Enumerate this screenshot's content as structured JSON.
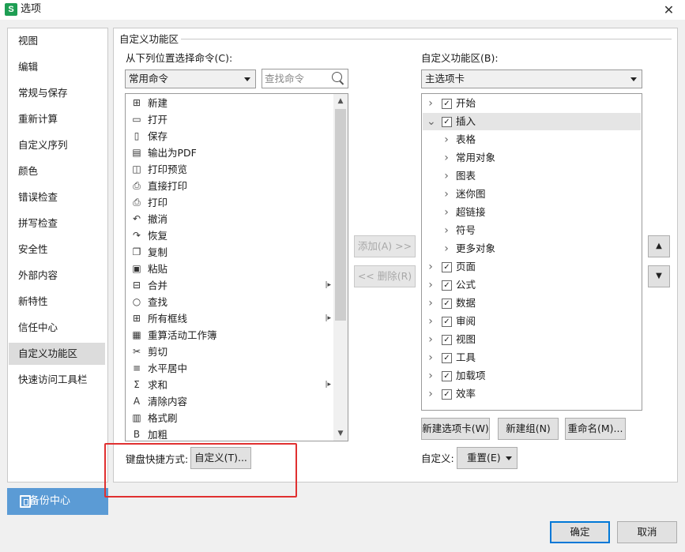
{
  "window": {
    "title": "选项",
    "app_badge": "S",
    "close_glyph": "✕"
  },
  "nav": {
    "items": [
      "视图",
      "编辑",
      "常规与保存",
      "重新计算",
      "自定义序列",
      "颜色",
      "错误检查",
      "拼写检查",
      "安全性",
      "外部内容",
      "新特性",
      "信任中心",
      "自定义功能区",
      "快速访问工具栏"
    ],
    "active": "自定义功能区"
  },
  "backup": {
    "label": "备份中心"
  },
  "section": {
    "title": "自定义功能区"
  },
  "left": {
    "choose_label": "从下列位置选择命令(C):",
    "choose_value": "常用命令",
    "search_placeholder": "查找命令",
    "commands": [
      {
        "label": "新建",
        "icon": "⊞"
      },
      {
        "label": "打开",
        "icon": "▭"
      },
      {
        "label": "保存",
        "icon": "▯"
      },
      {
        "label": "输出为PDF",
        "icon": "▤"
      },
      {
        "label": "打印预览",
        "icon": "◫"
      },
      {
        "label": "直接打印",
        "icon": "⎙"
      },
      {
        "label": "打印",
        "icon": "⎙"
      },
      {
        "label": "撤消",
        "icon": "↶"
      },
      {
        "label": "恢复",
        "icon": "↷"
      },
      {
        "label": "复制",
        "icon": "❐"
      },
      {
        "label": "粘贴",
        "icon": "▣"
      },
      {
        "label": "合并",
        "icon": "⊟",
        "submenu": true
      },
      {
        "label": "查找",
        "icon": "○"
      },
      {
        "label": "所有框线",
        "icon": "⊞",
        "submenu": true
      },
      {
        "label": "重算活动工作簿",
        "icon": "▦"
      },
      {
        "label": "剪切",
        "icon": "✂"
      },
      {
        "label": "水平居中",
        "icon": "≡"
      },
      {
        "label": "求和",
        "icon": "Σ",
        "submenu": true
      },
      {
        "label": "清除内容",
        "icon": "A"
      },
      {
        "label": "格式刷",
        "icon": "▥"
      },
      {
        "label": "加粗",
        "icon": "B"
      }
    ],
    "submenu_glyph": "|▸",
    "shortcut_label": "键盘快捷方式:",
    "customize_button": "自定义(T)..."
  },
  "middle": {
    "add_button": "添加(A) >>",
    "remove_button": "<< 删除(R)"
  },
  "right": {
    "ribbon_label": "自定义功能区(B):",
    "ribbon_value": "主选项卡",
    "tree": [
      {
        "label": "开始",
        "level": 0,
        "expanded": false,
        "checked": true
      },
      {
        "label": "插入",
        "level": 0,
        "expanded": true,
        "checked": true,
        "selected": true
      },
      {
        "label": "表格",
        "level": 1
      },
      {
        "label": "常用对象",
        "level": 1
      },
      {
        "label": "图表",
        "level": 1
      },
      {
        "label": "迷你图",
        "level": 1
      },
      {
        "label": "超链接",
        "level": 1
      },
      {
        "label": "符号",
        "level": 1
      },
      {
        "label": "更多对象",
        "level": 1
      },
      {
        "label": "页面",
        "level": 0,
        "expanded": false,
        "checked": true
      },
      {
        "label": "公式",
        "level": 0,
        "expanded": false,
        "checked": true
      },
      {
        "label": "数据",
        "level": 0,
        "expanded": false,
        "checked": true
      },
      {
        "label": "审阅",
        "level": 0,
        "expanded": false,
        "checked": true
      },
      {
        "label": "视图",
        "level": 0,
        "expanded": false,
        "checked": true
      },
      {
        "label": "工具",
        "level": 0,
        "expanded": false,
        "checked": true
      },
      {
        "label": "加载项",
        "level": 0,
        "expanded": false,
        "checked": true
      },
      {
        "label": "效率",
        "level": 0,
        "expanded": false,
        "checked": true
      }
    ],
    "new_tab_button": "新建选项卡(W)",
    "new_group_button": "新建组(N)",
    "rename_button": "重命名(M)...",
    "customize_label": "自定义:",
    "reset_button": "重置(E)",
    "move_up_glyph": "▲",
    "move_down_glyph": "▼"
  },
  "footer": {
    "ok": "确定",
    "cancel": "取消"
  },
  "colors": {
    "accent": "#0078d7",
    "backup_bg": "#5b9bd5",
    "highlight_box": "#e03030",
    "app_icon": "#1e9e53"
  }
}
